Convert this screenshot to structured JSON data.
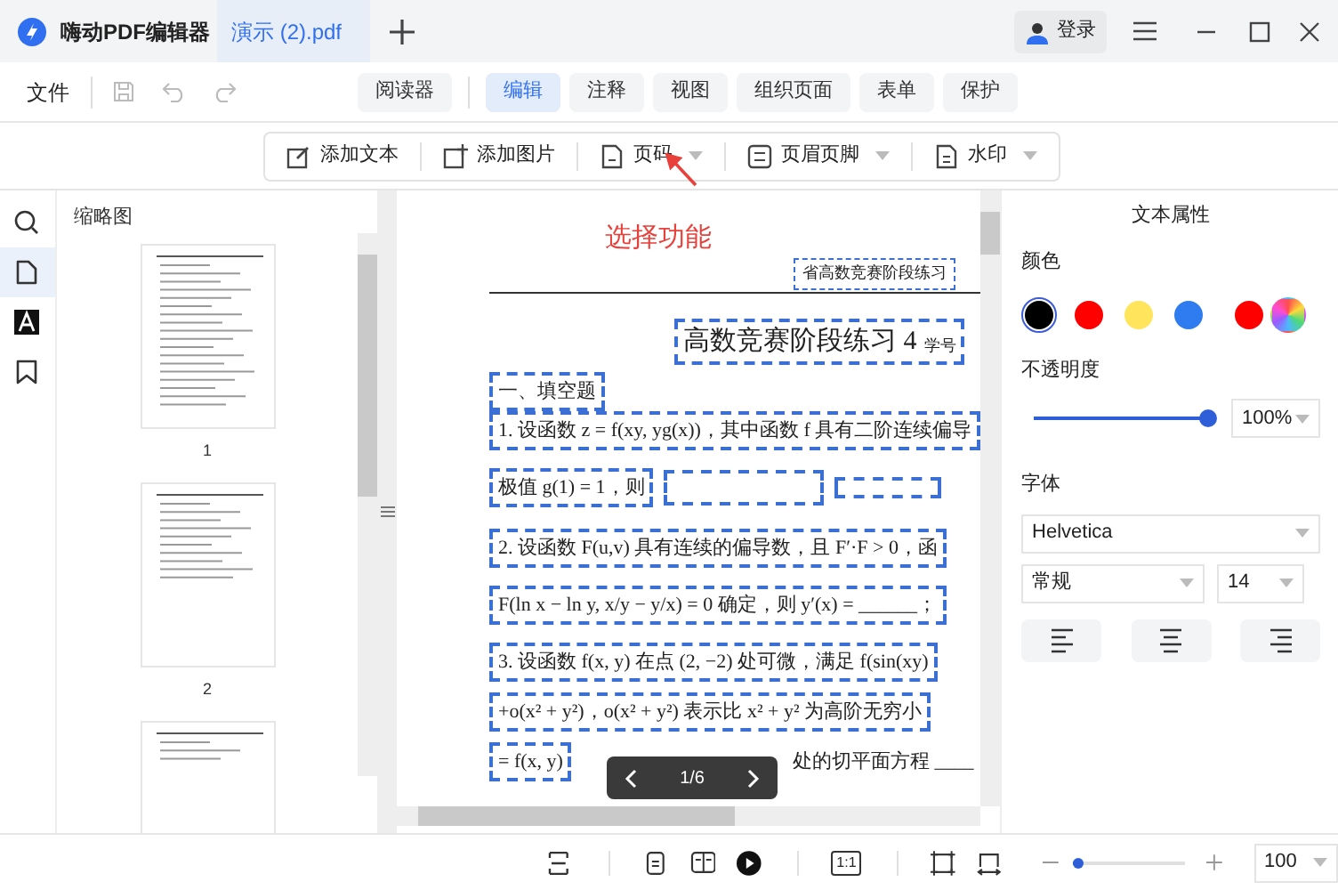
{
  "app": {
    "name": "嗨动PDF编辑器"
  },
  "tabs": [
    {
      "label": "演示 (2).pdf",
      "selected": true
    }
  ],
  "account": {
    "login": "登录"
  },
  "menu": {
    "file": "文件",
    "tabs": [
      {
        "label": "阅读器",
        "selected": false
      },
      {
        "label": "编辑",
        "selected": true
      },
      {
        "label": "注释",
        "selected": false
      },
      {
        "label": "视图",
        "selected": false
      },
      {
        "label": "组织页面",
        "selected": false
      },
      {
        "label": "表单",
        "selected": false
      },
      {
        "label": "保护",
        "selected": false
      }
    ]
  },
  "toolbar": [
    {
      "kind": "text",
      "label": "添加文本",
      "dropdown": false
    },
    {
      "kind": "image",
      "label": "添加图片",
      "dropdown": false
    },
    {
      "kind": "page-number",
      "label": "页码",
      "dropdown": true
    },
    {
      "kind": "header-footer",
      "label": "页眉页脚",
      "dropdown": true
    },
    {
      "kind": "watermark",
      "label": "水印",
      "dropdown": true
    }
  ],
  "sidebar": {
    "items": [
      {
        "kind": "search",
        "selected": false
      },
      {
        "kind": "page",
        "selected": true
      },
      {
        "kind": "text",
        "selected": false
      },
      {
        "kind": "bookmark",
        "selected": false
      }
    ],
    "title": "缩略图",
    "thumbnails": [
      {
        "label": "1"
      },
      {
        "label": "2"
      }
    ]
  },
  "document": {
    "callout": "选择功能",
    "header": "省高数竞赛阶段练习",
    "title": "高数竞赛阶段练习 4",
    "title_suffix": "学号",
    "lines": [
      "一、填空题",
      "1. 设函数 z = f(xy, yg(x))，其中函数 f 具有二阶连续偏导",
      "极值 g(1) = 1，则",
      "2. 设函数 F(u,v) 具有连续的偏导数，且 F′·F > 0，函",
      "F(ln x − ln y, x/y − y/x) = 0 确定，则 y′(x) = ______；",
      "3. 设函数 f(x, y) 在点 (2, −2) 处可微，满足 f(sin(xy)",
      "+o(x² + y²)，o(x² + y²) 表示比 x² + y² 为高阶无穷小",
      "= f(x, y)"
    ],
    "last_line_end": "处的切平面方程 ____",
    "pager": "1/6"
  },
  "properties": {
    "title": "文本属性",
    "color_label": "颜色",
    "colors": [
      {
        "kind": "swatch",
        "color": "#000000",
        "selected": true
      },
      {
        "kind": "swatch",
        "color": "#ff0000",
        "selected": false
      },
      {
        "kind": "swatch",
        "color": "#ffe45c",
        "selected": false
      },
      {
        "kind": "swatch",
        "color": "#2f7cf0",
        "selected": false
      },
      {
        "kind": "swatch",
        "color": "#ff0000",
        "selected": false
      },
      {
        "kind": "custom",
        "selected": false
      }
    ],
    "opacity_label": "不透明度",
    "opacity": {
      "level": 1,
      "value": "100%"
    },
    "font_label": "字体",
    "font": "Helvetica",
    "style": "常规",
    "size": "14"
  },
  "statusbar": {
    "actual_size": "1:1",
    "zoom": {
      "level": 0.05,
      "value": "100"
    }
  }
}
